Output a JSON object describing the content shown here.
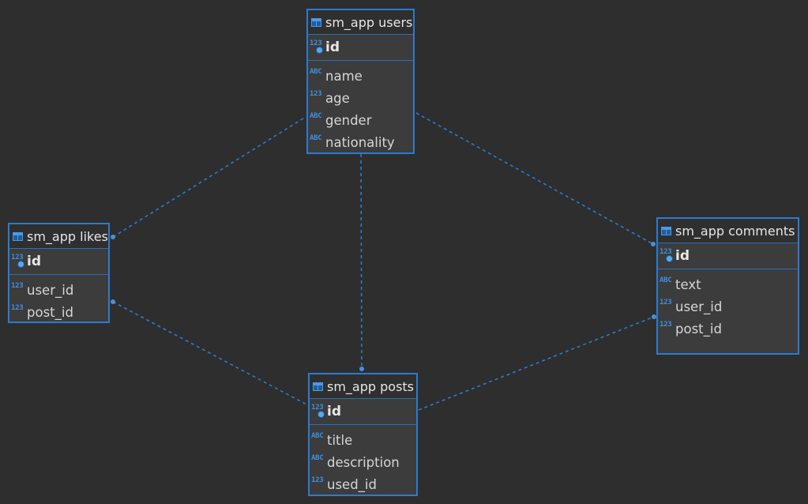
{
  "colors": {
    "background": "#2e2e2e",
    "entity_border": "#2b7bcf",
    "link": "#2b7bcf",
    "type_icon": "#3d8fe0"
  },
  "entities": {
    "users": {
      "title": "sm_app users",
      "pk": {
        "type": "123",
        "name": "id"
      },
      "columns": [
        {
          "type": "ABC",
          "name": "name"
        },
        {
          "type": "123",
          "name": "age"
        },
        {
          "type": "ABC",
          "name": "gender"
        },
        {
          "type": "ABC",
          "name": "nationality"
        }
      ]
    },
    "likes": {
      "title": "sm_app likes",
      "pk": {
        "type": "123",
        "name": "id"
      },
      "columns": [
        {
          "type": "123",
          "name": "user_id"
        },
        {
          "type": "123",
          "name": "post_id"
        }
      ]
    },
    "comments": {
      "title": "sm_app comments",
      "pk": {
        "type": "123",
        "name": "id"
      },
      "columns": [
        {
          "type": "ABC",
          "name": "text"
        },
        {
          "type": "123",
          "name": "user_id"
        },
        {
          "type": "123",
          "name": "post_id"
        }
      ]
    },
    "posts": {
      "title": "sm_app posts",
      "pk": {
        "type": "123",
        "name": "id"
      },
      "columns": [
        {
          "type": "ABC",
          "name": "title"
        },
        {
          "type": "ABC",
          "name": "description"
        },
        {
          "type": "123",
          "name": "used_id"
        }
      ]
    }
  },
  "relationships": [
    {
      "from": "likes",
      "to": "users"
    },
    {
      "from": "posts",
      "to": "users"
    },
    {
      "from": "comments",
      "to": "users"
    },
    {
      "from": "likes",
      "to": "posts"
    },
    {
      "from": "comments",
      "to": "posts"
    }
  ]
}
